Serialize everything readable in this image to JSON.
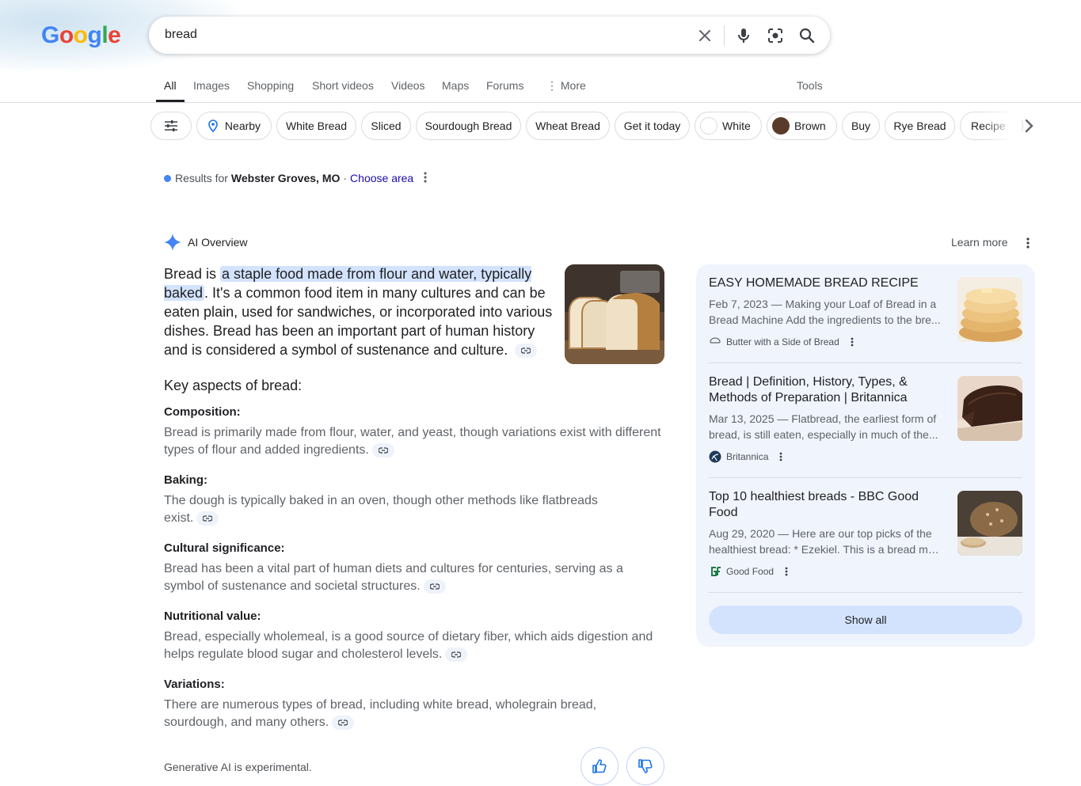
{
  "header": {
    "logo_text": "Google",
    "search_query": "bread"
  },
  "tabs": [
    {
      "label": "All"
    },
    {
      "label": "Images"
    },
    {
      "label": "Shopping"
    },
    {
      "label": "Short videos"
    },
    {
      "label": "Videos"
    },
    {
      "label": "Maps"
    },
    {
      "label": "Forums"
    },
    {
      "label": "More"
    }
  ],
  "tools_label": "Tools",
  "chips": [
    {
      "label": "Nearby"
    },
    {
      "label": "White Bread"
    },
    {
      "label": "Sliced"
    },
    {
      "label": "Sourdough Bread"
    },
    {
      "label": "Wheat Bread"
    },
    {
      "label": "Get it today"
    },
    {
      "label": "White",
      "swatch": "#ffffff"
    },
    {
      "label": "Brown",
      "swatch": "#5a3a28"
    },
    {
      "label": "Buy"
    },
    {
      "label": "Rye Bread"
    },
    {
      "label": "Recipe"
    }
  ],
  "location": {
    "prefix": "Results for",
    "place": "Webster Groves, MO",
    "separator": "·",
    "link": "Choose area"
  },
  "ai_overview": {
    "label": "AI Overview",
    "learn_more": "Learn more",
    "lead_start": "Bread is ",
    "lead_highlight": "a staple food made from flour and water, typically baked",
    "lead_rest": ". It's a common food item in many cultures and can be eaten plain, used for sandwiches, or incorporated into various dishes. Bread has been an important part of human history and is considered a symbol of sustenance and culture.",
    "key_heading": "Key aspects of bread:",
    "aspects": [
      {
        "title": "Composition:",
        "text": "Bread is primarily made from flour, water, and yeast, though variations exist with different types of flour and added ingredients."
      },
      {
        "title": "Baking:",
        "text": "The dough is typically baked in an oven, though other methods like flatbreads exist."
      },
      {
        "title": "Cultural significance:",
        "text": "Bread has been a vital part of human diets and cultures for centuries, serving as a symbol of sustenance and societal structures."
      },
      {
        "title": "Nutritional value:",
        "text": "Bread, especially wholemeal, is a good source of dietary fiber, which aids digestion and helps regulate blood sugar and cholesterol levels."
      },
      {
        "title": "Variations:",
        "text": "There are numerous types of bread, including white bread, wholegrain bread, sourdough, and many others."
      }
    ],
    "footer_note": "Generative AI is experimental."
  },
  "sources": [
    {
      "title": "EASY HOMEMADE BREAD RECIPE",
      "snippet_line1": "Feb 7, 2023 — Making your Loaf of Bread in a",
      "snippet_line2": "Bread Machine Add the ingredients to the bre...",
      "site": "Butter with a Side of Bread"
    },
    {
      "title": "Bread | Definition, History, Types, & Methods of Preparation | Britannica",
      "snippet_line1": "Mar 13, 2025 — Flatbread, the earliest form of",
      "snippet_line2": "bread, is still eaten, especially in much of the...",
      "site": "Britannica"
    },
    {
      "title": "Top 10 healthiest breads - BBC Good Food",
      "snippet_line1": "Aug 29, 2020 — Here are our top picks of the",
      "snippet_line2": "healthiest bread: * Ezekiel. This is a bread ma...",
      "site": "Good Food"
    }
  ],
  "show_all": "Show all",
  "colors": {
    "accent_blue": "#1a73e8",
    "link": "#1a0dab",
    "highlight": "#d3e3fd",
    "panel_bg": "#f0f4fc"
  }
}
